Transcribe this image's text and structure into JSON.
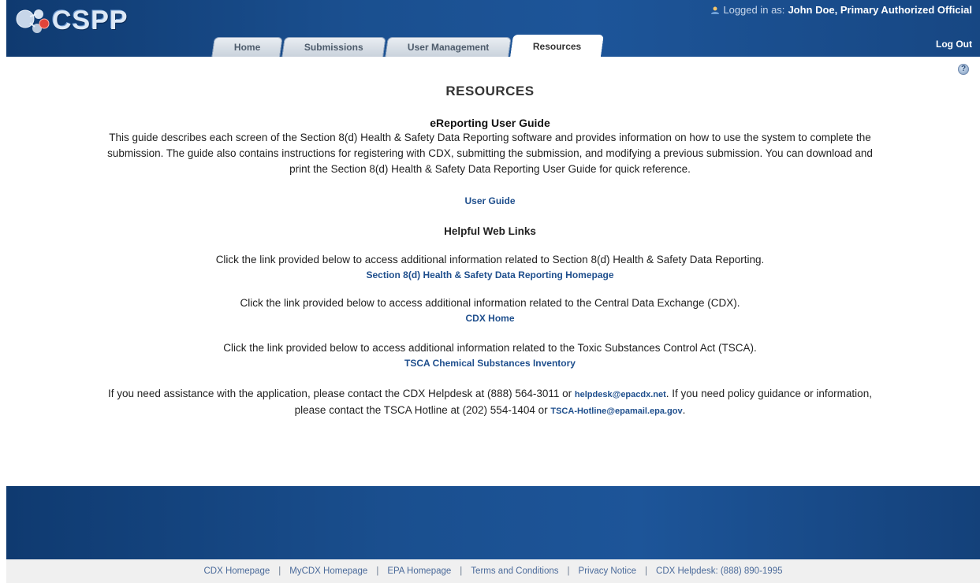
{
  "header": {
    "logo_text": "CSPP",
    "logged_in_prefix": "Logged in as:",
    "user_name": "John Doe, Primary Authorized Official",
    "logout_label": "Log Out",
    "tabs": [
      {
        "label": "Home"
      },
      {
        "label": "Submissions"
      },
      {
        "label": "User Management"
      },
      {
        "label": "Resources",
        "active": true
      }
    ]
  },
  "main": {
    "help_icon_glyph": "?",
    "title": "RESOURCES",
    "guide": {
      "heading": "eReporting User Guide",
      "description_lines": [
        "This guide describes each screen of the Section 8(d) Health & Safety Data Reporting software and provides information on how to use the system to complete the",
        "submission. The guide also contains instructions for registering with CDX, submitting the submission, and modifying a previous submission. You can download and",
        "print the Section 8(d) Health & Safety Data Reporting User Guide for quick reference."
      ],
      "link_label": "User Guide"
    },
    "web_links": {
      "heading": "Helpful Web Links",
      "items": [
        {
          "text": "Click the link provided below to access additional information related to Section 8(d) Health & Safety Data Reporting.",
          "link": "Section 8(d) Health & Safety Data Reporting Homepage"
        },
        {
          "text": "Click the link provided below to access additional information related to the Central Data Exchange (CDX).",
          "link": "CDX Home"
        },
        {
          "text": "Click the link provided below to access additional information related to the Toxic Substances Control Act (TSCA).",
          "link": "TSCA Chemical Substances Inventory"
        }
      ]
    },
    "contact": {
      "line1_text_a": "If you need assistance with the application, please contact the CDX Helpdesk at (888) 564-3011 or",
      "helpdesk_email": "helpdesk@epacdx.net",
      "line1_text_b": ". If you need policy guidance or information,",
      "line2_text": "please contact the TSCA Hotline at (202) 554-1404 or",
      "hotline_email": "TSCA-Hotline@epamail.epa.gov",
      "line2_end": "."
    }
  },
  "footer": {
    "links": [
      "CDX Homepage",
      "MyCDX Homepage",
      "EPA Homepage",
      "Terms and Conditions",
      "Privacy Notice",
      "CDX Helpdesk: (888) 890-1995"
    ],
    "separator": "|"
  },
  "colors": {
    "header_blue": "#1a4f8f",
    "link_blue": "#1f4f8d",
    "footer_bar": "#f0f0f0"
  }
}
